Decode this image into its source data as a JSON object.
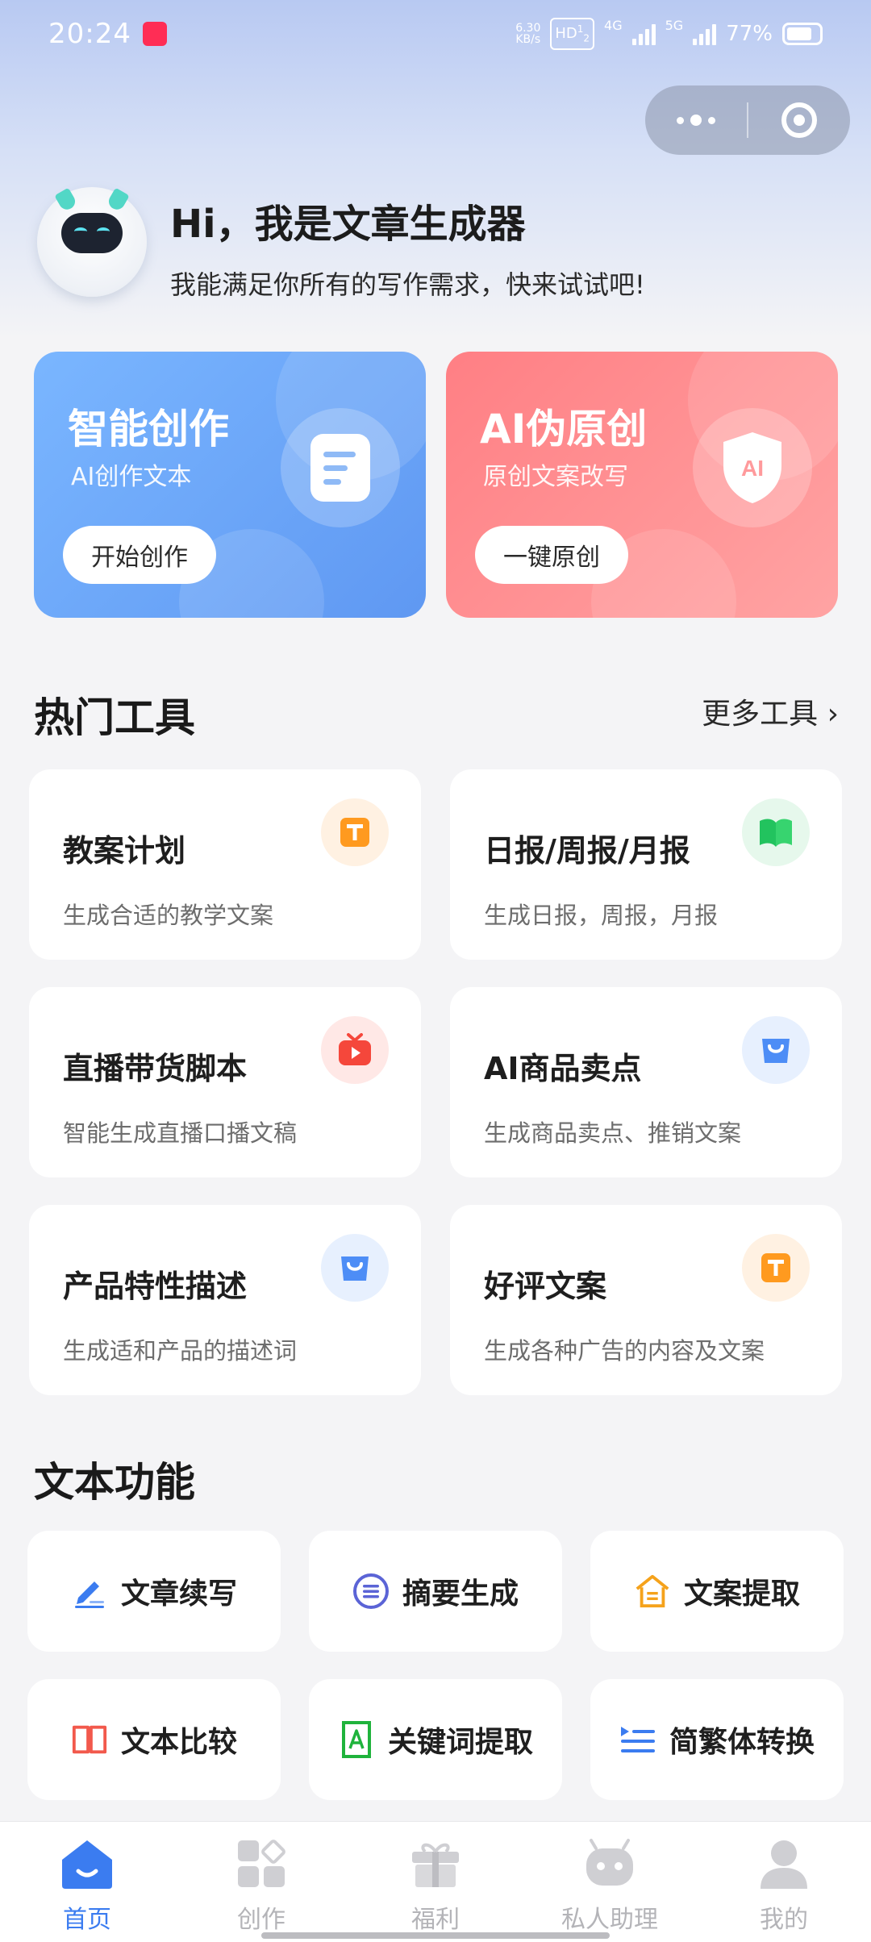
{
  "status_bar": {
    "time": "20:24",
    "net_speed_value": "6.30",
    "net_speed_unit": "KB/s",
    "hd_label": "HD",
    "sim1": "1",
    "sim2": "2",
    "net1": "4G",
    "net2": "5G",
    "battery": "77%"
  },
  "greeting": {
    "title": "Hi，我是文章生成器",
    "subtitle": "我能满足你所有的写作需求，快来试试吧!"
  },
  "feature_cards": [
    {
      "title": "智能创作",
      "subtitle": "AI创作文本",
      "button": "开始创作",
      "icon": "document-icon",
      "color": "#6aa6f8"
    },
    {
      "title": "AI伪原创",
      "subtitle": "原创文案改写",
      "button": "一键原创",
      "icon": "shield-ai-icon",
      "color": "#ff8a8d"
    }
  ],
  "hot_tools": {
    "title": "热门工具",
    "more": "更多工具",
    "items": [
      {
        "title": "教案计划",
        "desc": "生成合适的教学文案",
        "icon": "text-t-icon",
        "icon_color": "#ff9a1f",
        "icon_bg": "#fff1e2"
      },
      {
        "title": "日报/周报/月报",
        "desc": "生成日报，周报，月报",
        "icon": "book-icon",
        "icon_color": "#22c35e",
        "icon_bg": "#e6f8ec"
      },
      {
        "title": "直播带货脚本",
        "desc": "智能生成直播口播文稿",
        "icon": "tv-play-icon",
        "icon_color": "#f5473b",
        "icon_bg": "#ffe8e6"
      },
      {
        "title": "AI商品卖点",
        "desc": "生成商品卖点、推销文案",
        "icon": "shopping-bag-icon",
        "icon_color": "#4d8df6",
        "icon_bg": "#e7f0fe"
      },
      {
        "title": "产品特性描述",
        "desc": "生成适和产品的描述词",
        "icon": "shopping-bag-icon",
        "icon_color": "#4d8df6",
        "icon_bg": "#e7f0fe"
      },
      {
        "title": "好评文案",
        "desc": "生成各种广告的内容及文案",
        "icon": "text-t-icon",
        "icon_color": "#ff9a1f",
        "icon_bg": "#fff1e2"
      }
    ]
  },
  "text_functions": {
    "title": "文本功能",
    "items": [
      {
        "label": "文章续写",
        "icon": "pen-write-icon",
        "color": "#3b7cf0"
      },
      {
        "label": "摘要生成",
        "icon": "summary-icon",
        "color": "#5b64d6"
      },
      {
        "label": "文案提取",
        "icon": "home-text-icon",
        "color": "#f5a21b"
      },
      {
        "label": "文本比较",
        "icon": "open-book-icon",
        "color": "#f2594c"
      },
      {
        "label": "关键词提取",
        "icon": "keyword-a-icon",
        "color": "#1fb33c"
      },
      {
        "label": "简繁体转换",
        "icon": "list-convert-icon",
        "color": "#3b7cf0"
      }
    ]
  },
  "tab_bar": {
    "items": [
      {
        "label": "首页",
        "icon": "home-icon",
        "active": true
      },
      {
        "label": "创作",
        "icon": "create-grid-icon",
        "active": false
      },
      {
        "label": "福利",
        "icon": "gift-icon",
        "active": false
      },
      {
        "label": "私人助理",
        "icon": "robot-icon",
        "active": false
      },
      {
        "label": "我的",
        "icon": "profile-icon",
        "active": false
      }
    ]
  },
  "colors": {
    "accent": "#3b7cf0",
    "background": "#f4f4f6",
    "inactive_tab": "#b4b4b8"
  }
}
